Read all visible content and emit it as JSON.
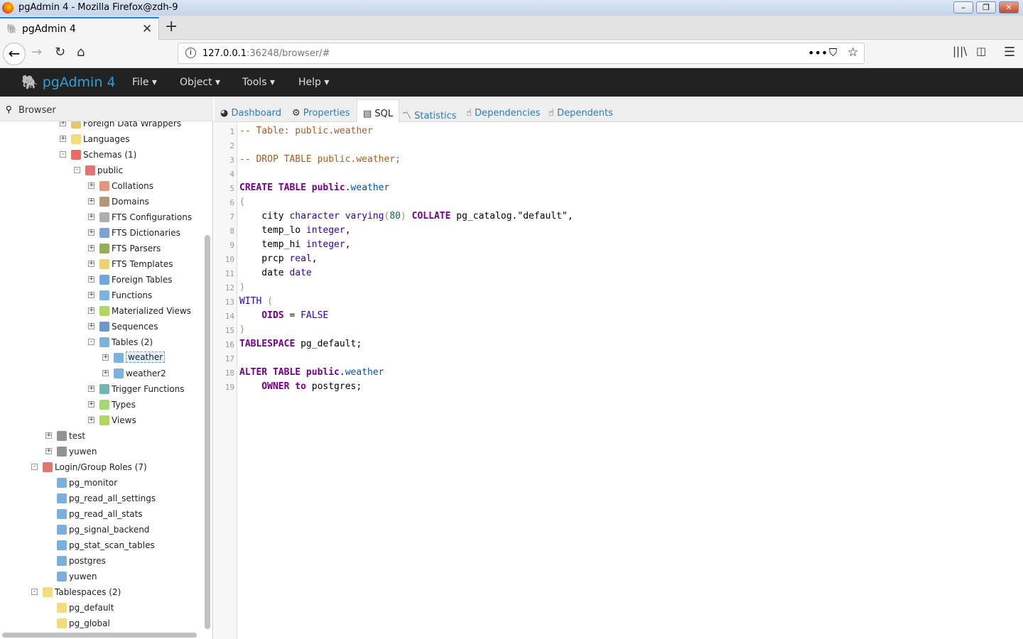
{
  "window": {
    "title": "pgAdmin 4 - Mozilla Firefox@zdh-9"
  },
  "browser": {
    "tab_title": "pgAdmin 4",
    "url_host": "127.0.0.1",
    "url_rest": ":36248/browser/#"
  },
  "app": {
    "brand": "pgAdmin 4",
    "menus": [
      "File",
      "Object",
      "Tools",
      "Help"
    ]
  },
  "left_panel": {
    "title": "Browser",
    "tree": [
      {
        "l": 2,
        "t": "Foreign Data Wrappers",
        "e": "+",
        "c": "#e0b84a"
      },
      {
        "l": 2,
        "t": "Languages",
        "e": "+",
        "c": "#f2d35a"
      },
      {
        "l": 2,
        "t": "Schemas (1)",
        "e": "-",
        "c": "#e04a3a"
      },
      {
        "l": 3,
        "t": "public",
        "e": "-",
        "c": "#d9534f"
      },
      {
        "l": 4,
        "t": "Collations",
        "e": "+",
        "c": "#e07a5f"
      },
      {
        "l": 4,
        "t": "Domains",
        "e": "+",
        "c": "#a67c52"
      },
      {
        "l": 4,
        "t": "FTS Configurations",
        "e": "+",
        "c": "#999"
      },
      {
        "l": 4,
        "t": "FTS Dictionaries",
        "e": "+",
        "c": "#5b8bc9"
      },
      {
        "l": 4,
        "t": "FTS Parsers",
        "e": "+",
        "c": "#7a9a2e"
      },
      {
        "l": 4,
        "t": "FTS Templates",
        "e": "+",
        "c": "#e8c547"
      },
      {
        "l": 4,
        "t": "Foreign Tables",
        "e": "+",
        "c": "#4a90d9"
      },
      {
        "l": 4,
        "t": "Functions",
        "e": "+",
        "c": "#5aa0d8"
      },
      {
        "l": 4,
        "t": "Materialized Views",
        "e": "+",
        "c": "#9acd32"
      },
      {
        "l": 4,
        "t": "Sequences",
        "e": "+",
        "c": "#4a7fc1"
      },
      {
        "l": 4,
        "t": "Tables (2)",
        "e": "-",
        "c": "#5a9fd6"
      },
      {
        "l": 5,
        "t": "weather",
        "e": "+",
        "c": "#5a9fd6",
        "sel": true
      },
      {
        "l": 5,
        "t": "weather2",
        "e": "+",
        "c": "#5a9fd6"
      },
      {
        "l": 4,
        "t": "Trigger Functions",
        "e": "+",
        "c": "#4aa3a0"
      },
      {
        "l": 4,
        "t": "Types",
        "e": "+",
        "c": "#8fd14f"
      },
      {
        "l": 4,
        "t": "Views",
        "e": "+",
        "c": "#9acd32"
      },
      {
        "l": 1,
        "t": "test",
        "e": "+",
        "c": "#777"
      },
      {
        "l": 1,
        "t": "yuwen",
        "e": "+",
        "c": "#777"
      },
      {
        "l": 0,
        "t": "Login/Group Roles (7)",
        "e": "-",
        "c": "#d9534f"
      },
      {
        "l": 1,
        "t": "pg_monitor",
        "c": "#5b9bd5"
      },
      {
        "l": 1,
        "t": "pg_read_all_settings",
        "c": "#5b9bd5"
      },
      {
        "l": 1,
        "t": "pg_read_all_stats",
        "c": "#5b9bd5"
      },
      {
        "l": 1,
        "t": "pg_signal_backend",
        "c": "#5b9bd5"
      },
      {
        "l": 1,
        "t": "pg_stat_scan_tables",
        "c": "#5b9bd5"
      },
      {
        "l": 1,
        "t": "postgres",
        "c": "#5b9bd5"
      },
      {
        "l": 1,
        "t": "yuwen",
        "c": "#5b9bd5"
      },
      {
        "l": 0,
        "t": "Tablespaces (2)",
        "e": "-",
        "c": "#f2d35a"
      },
      {
        "l": 1,
        "t": "pg_default",
        "c": "#f2d35a"
      },
      {
        "l": 1,
        "t": "pg_global",
        "c": "#f2d35a"
      }
    ]
  },
  "main": {
    "tabs": [
      "Dashboard",
      "Properties",
      "SQL",
      "Statistics",
      "Dependencies",
      "Dependents"
    ],
    "active_tab": "SQL",
    "sql_lines": [
      [
        [
          "c",
          "-- Table: public.weather"
        ]
      ],
      [],
      [
        [
          "c",
          "-- DROP TABLE public.weather;"
        ]
      ],
      [],
      [
        [
          "k",
          "CREATE TABLE public"
        ],
        [
          "",
          "."
        ],
        [
          "v",
          "weather"
        ]
      ],
      [
        [
          "p",
          "("
        ]
      ],
      [
        [
          "",
          "    city "
        ],
        [
          "b",
          "character varying"
        ],
        [
          "p",
          "("
        ],
        [
          "n",
          "80"
        ],
        [
          "p",
          ")"
        ],
        [
          "k",
          " COLLATE"
        ],
        [
          "",
          " pg_catalog.\"default\","
        ]
      ],
      [
        [
          "",
          "    temp_lo "
        ],
        [
          "b",
          "integer"
        ],
        [
          "",
          ","
        ]
      ],
      [
        [
          "",
          "    temp_hi "
        ],
        [
          "b",
          "integer"
        ],
        [
          "",
          ","
        ]
      ],
      [
        [
          "",
          "    prcp "
        ],
        [
          "b",
          "real"
        ],
        [
          "",
          ","
        ]
      ],
      [
        [
          "",
          "    date "
        ],
        [
          "b",
          "date"
        ]
      ],
      [
        [
          "p",
          ")"
        ]
      ],
      [
        [
          "b",
          "WITH"
        ],
        [
          "p",
          " ("
        ]
      ],
      [
        [
          "k",
          "    OIDS"
        ],
        [
          "",
          " = "
        ],
        [
          "b",
          "FALSE"
        ]
      ],
      [
        [
          "p",
          ")"
        ]
      ],
      [
        [
          "k",
          "TABLESPACE"
        ],
        [
          "",
          " pg_default;"
        ]
      ],
      [],
      [
        [
          "k",
          "ALTER TABLE public"
        ],
        [
          "",
          "."
        ],
        [
          "v",
          "weather"
        ]
      ],
      [
        [
          "k",
          "    OWNER to"
        ],
        [
          "",
          " postgres;"
        ]
      ]
    ]
  }
}
